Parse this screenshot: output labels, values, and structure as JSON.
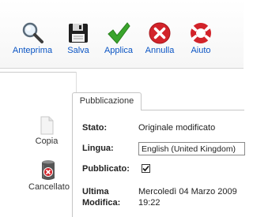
{
  "toolbar": {
    "buttons": [
      {
        "label": "Anteprima",
        "icon": "magnifier-icon"
      },
      {
        "label": "Salva",
        "icon": "floppy-disk-icon"
      },
      {
        "label": "Applica",
        "icon": "checkmark-icon"
      },
      {
        "label": "Annulla",
        "icon": "cancel-x-icon"
      },
      {
        "label": "Aiuto",
        "icon": "lifebuoy-icon"
      }
    ],
    "colors": {
      "label": "#0b55c4",
      "applica_green": "#3aa52c",
      "annulla_red": "#d2232a"
    }
  },
  "sidebar": {
    "copy_label": "Copia",
    "trash_label": "Cancellato"
  },
  "publish_panel": {
    "tab_label": "Pubblicazione",
    "stato_label": "Stato:",
    "stato_value": "Originale modificato",
    "lingua_label": "Lingua:",
    "lingua_value": "English (United Kingdom)",
    "pubblicato_label": "Pubblicato:",
    "pubblicato_checked": true,
    "ultima_label": "Ultima",
    "modifica_label": "Modifica:",
    "date_value": "Mercoledì 04 Marzo 2009",
    "time_value": "19:22"
  }
}
